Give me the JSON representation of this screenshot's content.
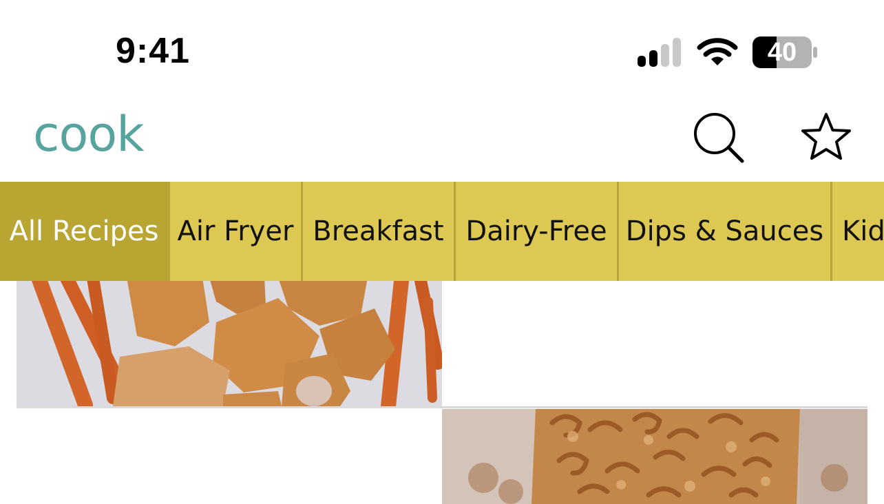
{
  "status_bar": {
    "time": "9:41",
    "battery_level": "40",
    "icons": [
      "cellular-signal-icon",
      "wifi-icon",
      "battery-icon"
    ]
  },
  "header": {
    "brand": "cook",
    "actions": [
      {
        "name": "search",
        "icon": "search-icon"
      },
      {
        "name": "favorites",
        "icon": "star-icon"
      }
    ]
  },
  "categories": [
    {
      "label": "All Recipes",
      "active": true
    },
    {
      "label": "Air Fryer",
      "active": false
    },
    {
      "label": "Breakfast",
      "active": false
    },
    {
      "label": "Dairy-Free",
      "active": false
    },
    {
      "label": "Dips & Sauces",
      "active": false
    },
    {
      "label": "Kid",
      "active": false
    }
  ],
  "colors": {
    "brand": "#57a39e",
    "category_bar": "#dcc852",
    "category_active": "#b9a532"
  }
}
